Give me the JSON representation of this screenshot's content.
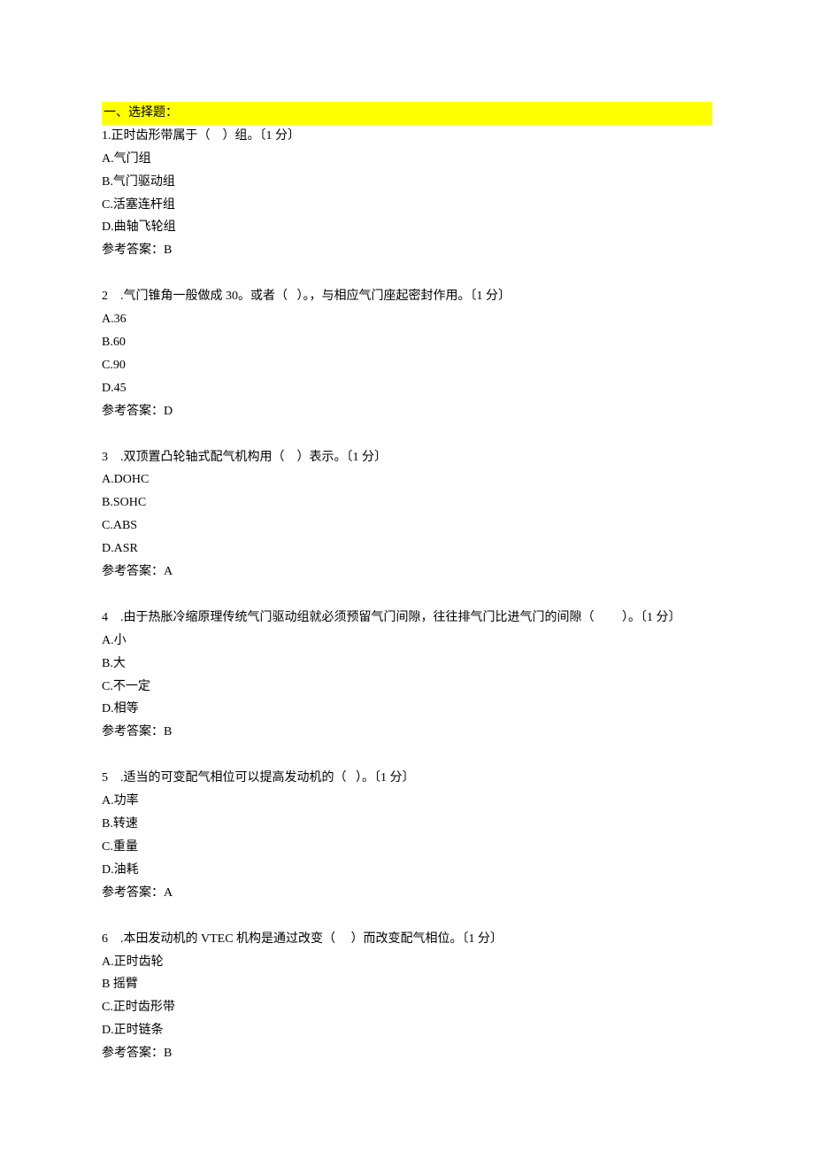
{
  "section_title": "一、选择题：",
  "questions": [
    {
      "num": "1.",
      "stem_pre": "正时齿形带属于（",
      "blank": "    ",
      "stem_post": "）组。〔1 分〕",
      "options": [
        {
          "label": "A.",
          "text": "气门组"
        },
        {
          "label": "B.",
          "text": "气门驱动组"
        },
        {
          "label": "C.",
          "text": "活塞连杆组"
        },
        {
          "label": "D.",
          "text": "曲轴飞轮组"
        }
      ],
      "answer_label": "参考答案：",
      "answer": "B"
    },
    {
      "num": "2    .",
      "stem_pre": "气门锥角一般做成 30。或者（",
      "blank": "   ",
      "stem_post": "）。，与相应气门座起密封作用。〔1 分〕",
      "options": [
        {
          "label": "A.",
          "text": "36"
        },
        {
          "label": "B.",
          "text": "60"
        },
        {
          "label": "C.",
          "text": "90"
        },
        {
          "label": "D.",
          "text": "45"
        }
      ],
      "answer_label": "参考答案：",
      "answer": "D"
    },
    {
      "num": "3    .",
      "stem_pre": "双顶置凸轮轴式配气机构用（",
      "blank": "    ",
      "stem_post": "）表示。〔1 分〕",
      "options": [
        {
          "label": "A.",
          "text": "DOHC"
        },
        {
          "label": "B.",
          "text": "SOHC"
        },
        {
          "label": "C.",
          "text": "ABS"
        },
        {
          "label": "D.",
          "text": "ASR"
        }
      ],
      "answer_label": "参考答案：",
      "answer": "A"
    },
    {
      "num": "4    .",
      "stem_pre": "由于热胀冷缩原理传统气门驱动组就必须预留气门间隙，往往排气门比进气门的间隙（",
      "blank": "         ",
      "stem_post": "）。〔1 分〕",
      "options": [
        {
          "label": "A.",
          "text": "小"
        },
        {
          "label": "B.",
          "text": "大"
        },
        {
          "label": "C.",
          "text": "不一定"
        },
        {
          "label": "D.",
          "text": "相等"
        }
      ],
      "answer_label": "参考答案：",
      "answer": "B"
    },
    {
      "num": "5    .",
      "stem_pre": "适当的可变配气相位可以提高发动机的（",
      "blank": "   ",
      "stem_post": "）。〔1 分〕",
      "options": [
        {
          "label": "A.",
          "text": "功率"
        },
        {
          "label": "B.",
          "text": "转速"
        },
        {
          "label": "C.",
          "text": "重量"
        },
        {
          "label": "D.",
          "text": "油耗"
        }
      ],
      "answer_label": "参考答案：",
      "answer": "A"
    },
    {
      "num": "6    .",
      "stem_pre": "本田发动机的 VTEC 机构是通过改变（",
      "blank": "     ",
      "stem_post": "）而改变配气相位。〔1 分〕",
      "options": [
        {
          "label": "A.",
          "text": "正时齿轮"
        },
        {
          "label": "B ",
          "text": "摇臂"
        },
        {
          "label": "C.",
          "text": "正时齿形带"
        },
        {
          "label": "D.",
          "text": "正时链条"
        }
      ],
      "answer_label": "参考答案：",
      "answer": "B"
    }
  ]
}
